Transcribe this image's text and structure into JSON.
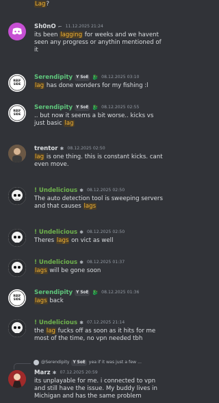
{
  "colors": {
    "background": "#313338",
    "mention_highlight": "#f0b132",
    "name_shono": "#dbdee1",
    "name_serendipity": "#5fc77c",
    "name_trentor": "#dbdee1",
    "name_undelicious": "#6fb24d",
    "name_marz": "#dbdee1"
  },
  "messages": [
    {
      "id": "top",
      "body": [
        {
          "t": "Lag",
          "hl": true
        },
        {
          "t": "?"
        }
      ]
    },
    {
      "id": "shono",
      "author": "Sh0nO",
      "author_icon": "bracket-icon",
      "timestamp": "11.12.2025 21:24",
      "avatar": "discord-logo",
      "body": [
        {
          "t": "its been "
        },
        {
          "t": "lagging",
          "hl": true
        },
        {
          "t": " for weeks and we havent seen any progress or anythin mentioned of it"
        }
      ]
    },
    {
      "id": "serendipity1",
      "author": "Serendipity",
      "badge": "Y SoE",
      "author_icon": "dragon-icon",
      "timestamp": "08.12.2025 03:10",
      "avatar": "lure-logo",
      "body": [
        {
          "t": "lag",
          "hl": true
        },
        {
          "t": " has done wonders for my fishing :l"
        }
      ]
    },
    {
      "id": "serendipity2",
      "author": "Serendipity",
      "badge": "Y SoE",
      "author_icon": "dragon-icon",
      "timestamp": "08.12.2025 02:55",
      "avatar": "lure-logo",
      "body": [
        {
          "t": ".. but now it seems a bit worse.. kicks vs just basic "
        },
        {
          "t": "lag",
          "hl": true
        }
      ]
    },
    {
      "id": "trentor",
      "author": "trentor",
      "author_icon": "bug-icon",
      "timestamp": "08.12.2025 02:50",
      "avatar": "photo-avatar",
      "body": [
        {
          "t": "lag",
          "hl": true
        },
        {
          "t": " is one thing. this is constant kicks. cant even move."
        }
      ]
    },
    {
      "id": "undelicious1",
      "author": "! Undelicious",
      "author_icon": "bug-icon",
      "timestamp": "08.12.2025 02:50",
      "avatar": "skull-avatar",
      "body": [
        {
          "t": "The auto detection tool is sweeping servers and that causes "
        },
        {
          "t": "lags",
          "hl": true
        }
      ]
    },
    {
      "id": "undelicious2",
      "author": "! Undelicious",
      "author_icon": "bug-icon",
      "timestamp": "08.12.2025 02:50",
      "avatar": "skull-avatar",
      "body": [
        {
          "t": "Theres "
        },
        {
          "t": "lags",
          "hl": true
        },
        {
          "t": " on vict as well"
        }
      ]
    },
    {
      "id": "undelicious3",
      "author": "! Undelicious",
      "author_icon": "bug-icon",
      "timestamp": "08.12.2025 01:37",
      "avatar": "skull-avatar",
      "body": [
        {
          "t": "lags",
          "hl": true
        },
        {
          "t": " will be gone soon"
        }
      ]
    },
    {
      "id": "serendipity3",
      "author": "Serendipity",
      "badge": "Y SoE",
      "author_icon": "dragon-icon",
      "timestamp": "08.12.2025 01:36",
      "avatar": "lure-logo",
      "body": [
        {
          "t": "lags",
          "hl": true
        },
        {
          "t": " back"
        }
      ]
    },
    {
      "id": "undelicious4",
      "author": "! Undelicious",
      "author_icon": "bug-icon",
      "timestamp": "07.12.2025 21:14",
      "avatar": "skull-avatar",
      "body": [
        {
          "t": "the "
        },
        {
          "t": "lag",
          "hl": true
        },
        {
          "t": " fucks off as soon as it hits for me most of the time, no vpn needed tbh"
        }
      ]
    },
    {
      "id": "marz",
      "reply": {
        "author": "@Serendipity",
        "badge": "Y SoE",
        "text": "yea if it was just a few ..."
      },
      "author": "Marz",
      "author_icon": "bug-icon",
      "timestamp": "07.12.2025 20:59",
      "avatar": "character-avatar",
      "body": [
        {
          "t": "its unplayable for me. i connected to vpn and still have the issue. My buddy lives in Michigan and has the same problem"
        }
      ]
    }
  ]
}
